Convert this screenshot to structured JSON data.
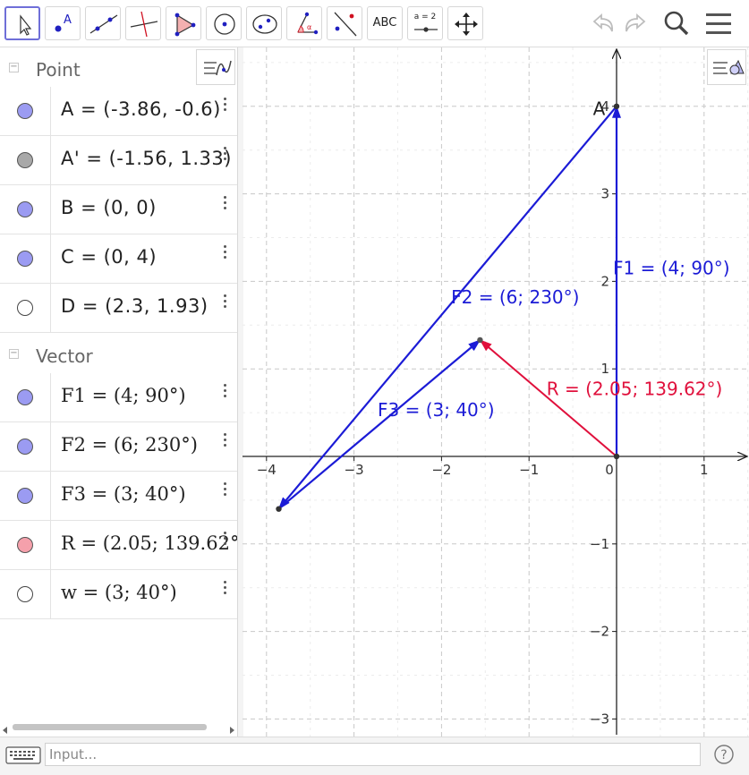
{
  "toolbar": {
    "tools": [
      {
        "name": "move-tool",
        "active": true
      },
      {
        "name": "point-tool",
        "label": "A"
      },
      {
        "name": "line-tool"
      },
      {
        "name": "perpendicular-line-tool"
      },
      {
        "name": "polygon-tool"
      },
      {
        "name": "circle-tool"
      },
      {
        "name": "conic-tool"
      },
      {
        "name": "angle-tool",
        "label": "α"
      },
      {
        "name": "reflect-tool"
      },
      {
        "name": "text-tool",
        "label": "ABC"
      },
      {
        "name": "slider-tool",
        "label": "a = 2"
      },
      {
        "name": "move-graphics-tool"
      }
    ],
    "undo_icon": "undo-icon",
    "redo_icon": "redo-icon",
    "search_icon": "search-icon",
    "menu_icon": "menu-icon"
  },
  "algebra": {
    "categories": [
      {
        "label": "Point",
        "toggle": "−"
      },
      {
        "label": "Vector",
        "toggle": "−"
      }
    ],
    "points": [
      {
        "expr": "A = (-3.86, -0.6)",
        "color": "#9b9bf2"
      },
      {
        "expr": "A' = (-1.56, 1.33)",
        "color": "#a8a8a8"
      },
      {
        "expr": "B = (0, 0)",
        "color": "#9b9bf2"
      },
      {
        "expr": "C = (0, 4)",
        "color": "#9b9bf2"
      },
      {
        "expr": "D = (2.3, 1.93)",
        "color": "#ffffff"
      }
    ],
    "vectors": [
      {
        "expr": "F1 = (4; 90°)",
        "color": "#9b9bf2"
      },
      {
        "expr": "F2 = (6; 230°)",
        "color": "#9b9bf2"
      },
      {
        "expr": "F3 = (3; 40°)",
        "color": "#9b9bf2"
      },
      {
        "expr": "R = (2.05; 139.62°)",
        "color": "#f5a0ab"
      },
      {
        "expr": "w = (3; 40°)",
        "color": "#ffffff"
      }
    ]
  },
  "input": {
    "placeholder": "Input..."
  },
  "graphics": {
    "x_ticks": [
      "−4",
      "−3",
      "−2",
      "−1",
      "0",
      "1"
    ],
    "y_ticks": [
      "4",
      "3",
      "2",
      "1",
      "−1",
      "−2",
      "−3"
    ],
    "labels": {
      "F1": "F1 = (4; 90°)",
      "F2": "F2 = (6; 230°)",
      "F3": "F3 = (3; 40°)",
      "R": "R = (2.05; 139.62°)",
      "A": "A"
    },
    "colors": {
      "blue": "#1b1bd6",
      "red": "#e0103c"
    }
  }
}
